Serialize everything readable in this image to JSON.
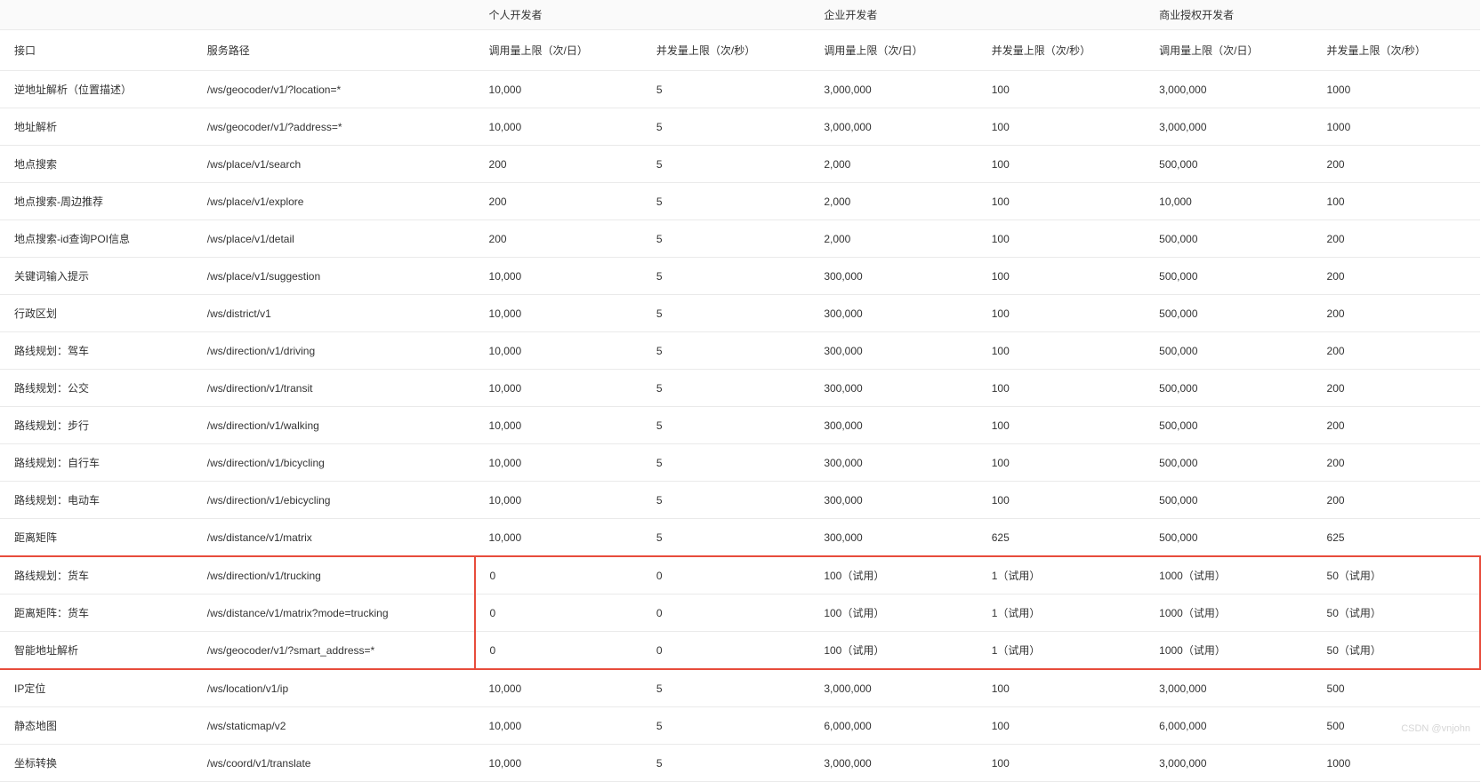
{
  "headers": {
    "group_blank": "",
    "group_personal": "个人开发者",
    "group_enterprise": "企业开发者",
    "group_commercial": "商业授权开发者",
    "api": "接口",
    "path": "服务路径",
    "call_limit": "调用量上限（次/日）",
    "concurrency_limit": "并发量上限（次/秒）"
  },
  "rows": [
    {
      "api": "逆地址解析（位置描述）",
      "path": "/ws/geocoder/v1/?location=*",
      "p_call": "10,000",
      "p_con": "5",
      "e_call": "3,000,000",
      "e_con": "100",
      "c_call": "3,000,000",
      "c_con": "1000",
      "hl": false
    },
    {
      "api": "地址解析",
      "path": "/ws/geocoder/v1/?address=*",
      "p_call": "10,000",
      "p_con": "5",
      "e_call": "3,000,000",
      "e_con": "100",
      "c_call": "3,000,000",
      "c_con": "1000",
      "hl": false
    },
    {
      "api": "地点搜索",
      "path": "/ws/place/v1/search",
      "p_call": "200",
      "p_con": "5",
      "e_call": "2,000",
      "e_con": "100",
      "c_call": "500,000",
      "c_con": "200",
      "hl": false
    },
    {
      "api": "地点搜索-周边推荐",
      "path": "/ws/place/v1/explore",
      "p_call": "200",
      "p_con": "5",
      "e_call": "2,000",
      "e_con": "100",
      "c_call": "10,000",
      "c_con": "100",
      "hl": false
    },
    {
      "api": "地点搜索-id查询POI信息",
      "path": "/ws/place/v1/detail",
      "p_call": "200",
      "p_con": "5",
      "e_call": "2,000",
      "e_con": "100",
      "c_call": "500,000",
      "c_con": "200",
      "hl": false
    },
    {
      "api": "关键词输入提示",
      "path": "/ws/place/v1/suggestion",
      "p_call": "10,000",
      "p_con": "5",
      "e_call": "300,000",
      "e_con": "100",
      "c_call": "500,000",
      "c_con": "200",
      "hl": false
    },
    {
      "api": "行政区划",
      "path": "/ws/district/v1",
      "p_call": "10,000",
      "p_con": "5",
      "e_call": "300,000",
      "e_con": "100",
      "c_call": "500,000",
      "c_con": "200",
      "hl": false
    },
    {
      "api": "路线规划：驾车",
      "path": "/ws/direction/v1/driving",
      "p_call": "10,000",
      "p_con": "5",
      "e_call": "300,000",
      "e_con": "100",
      "c_call": "500,000",
      "c_con": "200",
      "hl": false
    },
    {
      "api": "路线规划：公交",
      "path": "/ws/direction/v1/transit",
      "p_call": "10,000",
      "p_con": "5",
      "e_call": "300,000",
      "e_con": "100",
      "c_call": "500,000",
      "c_con": "200",
      "hl": false
    },
    {
      "api": "路线规划：步行",
      "path": "/ws/direction/v1/walking",
      "p_call": "10,000",
      "p_con": "5",
      "e_call": "300,000",
      "e_con": "100",
      "c_call": "500,000",
      "c_con": "200",
      "hl": false
    },
    {
      "api": "路线规划：自行车",
      "path": "/ws/direction/v1/bicycling",
      "p_call": "10,000",
      "p_con": "5",
      "e_call": "300,000",
      "e_con": "100",
      "c_call": "500,000",
      "c_con": "200",
      "hl": false
    },
    {
      "api": "路线规划：电动车",
      "path": "/ws/direction/v1/ebicycling",
      "p_call": "10,000",
      "p_con": "5",
      "e_call": "300,000",
      "e_con": "100",
      "c_call": "500,000",
      "c_con": "200",
      "hl": false
    },
    {
      "api": "距离矩阵",
      "path": "/ws/distance/v1/matrix",
      "p_call": "10,000",
      "p_con": "5",
      "e_call": "300,000",
      "e_con": "625",
      "c_call": "500,000",
      "c_con": "625",
      "hl": false
    },
    {
      "api": "路线规划：货车",
      "path": "/ws/direction/v1/trucking",
      "p_call": "0",
      "p_con": "0",
      "e_call": "100（试用）",
      "e_con": "1（试用）",
      "c_call": "1000（试用）",
      "c_con": "50（试用）",
      "hl": true,
      "hl_top": true
    },
    {
      "api": "距离矩阵：货车",
      "path": "/ws/distance/v1/matrix?mode=trucking",
      "p_call": "0",
      "p_con": "0",
      "e_call": "100（试用）",
      "e_con": "1（试用）",
      "c_call": "1000（试用）",
      "c_con": "50（试用）",
      "hl": true
    },
    {
      "api": "智能地址解析",
      "path": "/ws/geocoder/v1/?smart_address=*",
      "p_call": "0",
      "p_con": "0",
      "e_call": "100（试用）",
      "e_con": "1（试用）",
      "c_call": "1000（试用）",
      "c_con": "50（试用）",
      "hl": true,
      "hl_bot": true
    },
    {
      "api": "IP定位",
      "path": "/ws/location/v1/ip",
      "p_call": "10,000",
      "p_con": "5",
      "e_call": "3,000,000",
      "e_con": "100",
      "c_call": "3,000,000",
      "c_con": "500",
      "hl": false
    },
    {
      "api": "静态地图",
      "path": "/ws/staticmap/v2",
      "p_call": "10,000",
      "p_con": "5",
      "e_call": "6,000,000",
      "e_con": "100",
      "c_call": "6,000,000",
      "c_con": "500",
      "hl": false
    },
    {
      "api": "坐标转换",
      "path": "/ws/coord/v1/translate",
      "p_call": "10,000",
      "p_con": "5",
      "e_call": "3,000,000",
      "e_con": "100",
      "c_call": "3,000,000",
      "c_con": "1000",
      "hl": false
    }
  ],
  "watermark": "CSDN @vnjohn"
}
